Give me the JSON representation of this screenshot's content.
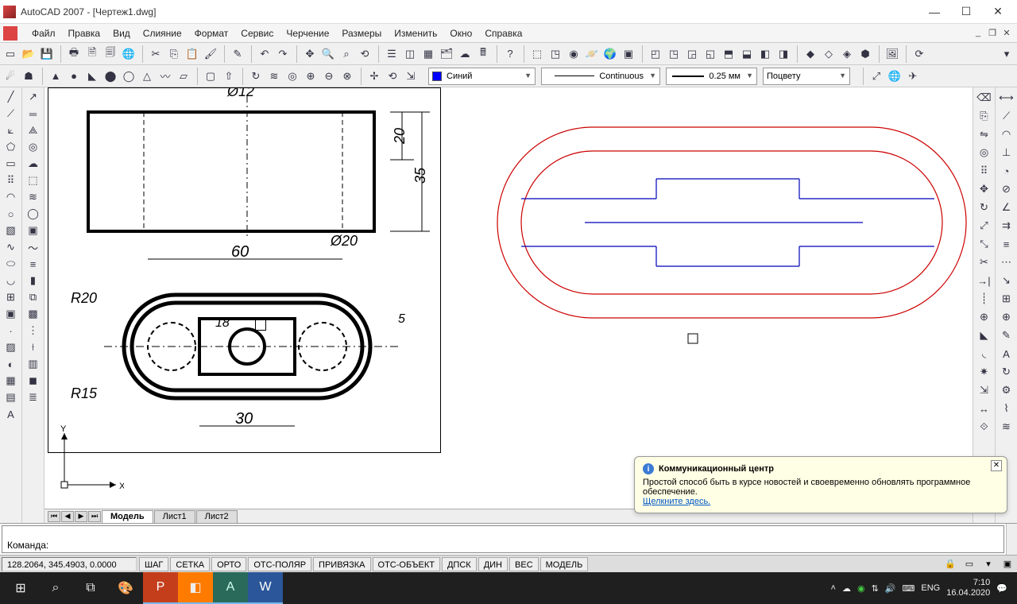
{
  "app": {
    "title": "AutoCAD 2007 - [Чертеж1.dwg]"
  },
  "menu": {
    "file": "Файл",
    "edit": "Правка",
    "view": "Вид",
    "insert": "Слияние",
    "format": "Формат",
    "tools": "Сервис",
    "draw": "Черчение",
    "dimension": "Размеры",
    "modify": "Изменить",
    "window": "Окно",
    "help": "Справка"
  },
  "props": {
    "color_name": "Синий",
    "color_hex": "#0000ff",
    "linetype": "Continuous",
    "lineweight": "0.25 мм",
    "plotstyle": "Поцвету"
  },
  "tabs": {
    "model": "Модель",
    "sheet1": "Лист1",
    "sheet2": "Лист2"
  },
  "command": {
    "prompt": "Команда:"
  },
  "status": {
    "coords": "128.2064, 345.4903, 0.0000",
    "snap": "ШАГ",
    "grid": "СЕТКА",
    "ortho": "ОРТО",
    "polar": "ОТС-ПОЛЯР",
    "osnap": "ПРИВЯЗКА",
    "otrack": "ОТС-ОБЪЕКТ",
    "ducs": "ДПСК",
    "dyn": "ДИН",
    "lwt": "ВЕС",
    "model": "МОДЕЛЬ"
  },
  "popup": {
    "title": "Коммуникационный центр",
    "body": "Простой способ быть в курсе новостей и своевременно обновлять программное обеспечение.",
    "link": "Щелкните здесь."
  },
  "drawing_labels": {
    "d12": "Ø12",
    "d20": "Ø20",
    "h20": "20",
    "h35": "35",
    "w60": "60",
    "w30": "30",
    "w18": "18",
    "r20": "R20",
    "r15": "R15",
    "t5": "5",
    "axisX": "X",
    "axisY": "Y"
  },
  "taskbar": {
    "lang": "ENG",
    "time": "7:10",
    "date": "16.04.2020"
  }
}
